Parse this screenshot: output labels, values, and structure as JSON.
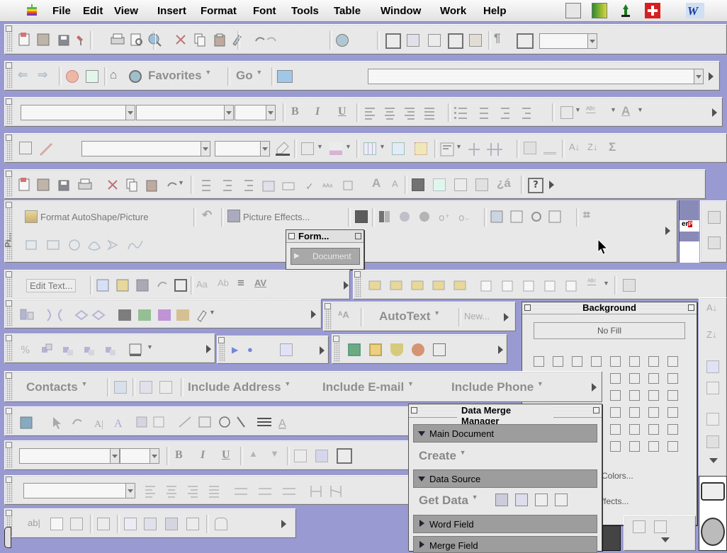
{
  "menubar": {
    "items": [
      "File",
      "Edit",
      "View",
      "Insert",
      "Format",
      "Font",
      "Tools",
      "Table",
      "Window",
      "Work",
      "Help"
    ]
  },
  "toolbars": {
    "web": {
      "favorites": "Favorites",
      "go": "Go"
    },
    "picture": {
      "format_autoshape": "Format AutoShape/Picture",
      "picture_effects": "Picture Effects...",
      "vertical_label": "Pi..."
    },
    "form_palette": {
      "title": "Form...",
      "document_button": "Document"
    },
    "wordart": {
      "edit_text": "Edit Text..."
    },
    "autotext": {
      "label": "AutoText",
      "new": "New..."
    },
    "contacts": {
      "contacts": "Contacts",
      "include_address": "Include Address",
      "include_email": "Include E-mail",
      "include_phone": "Include Phone"
    }
  },
  "background_palette": {
    "title": "Background",
    "no_fill": "No Fill",
    "colors": "Colors...",
    "effects": "ffects..."
  },
  "data_merge_manager": {
    "title": "Data Merge Manager",
    "main_document": "Main Document",
    "create": "Create",
    "data_source": "Data Source",
    "get_data": "Get Data",
    "word_field": "Word Field",
    "merge_field": "Merge Field"
  },
  "colors": {
    "accent": "#9a9ad2",
    "toolbar": "#e9e9e9"
  }
}
